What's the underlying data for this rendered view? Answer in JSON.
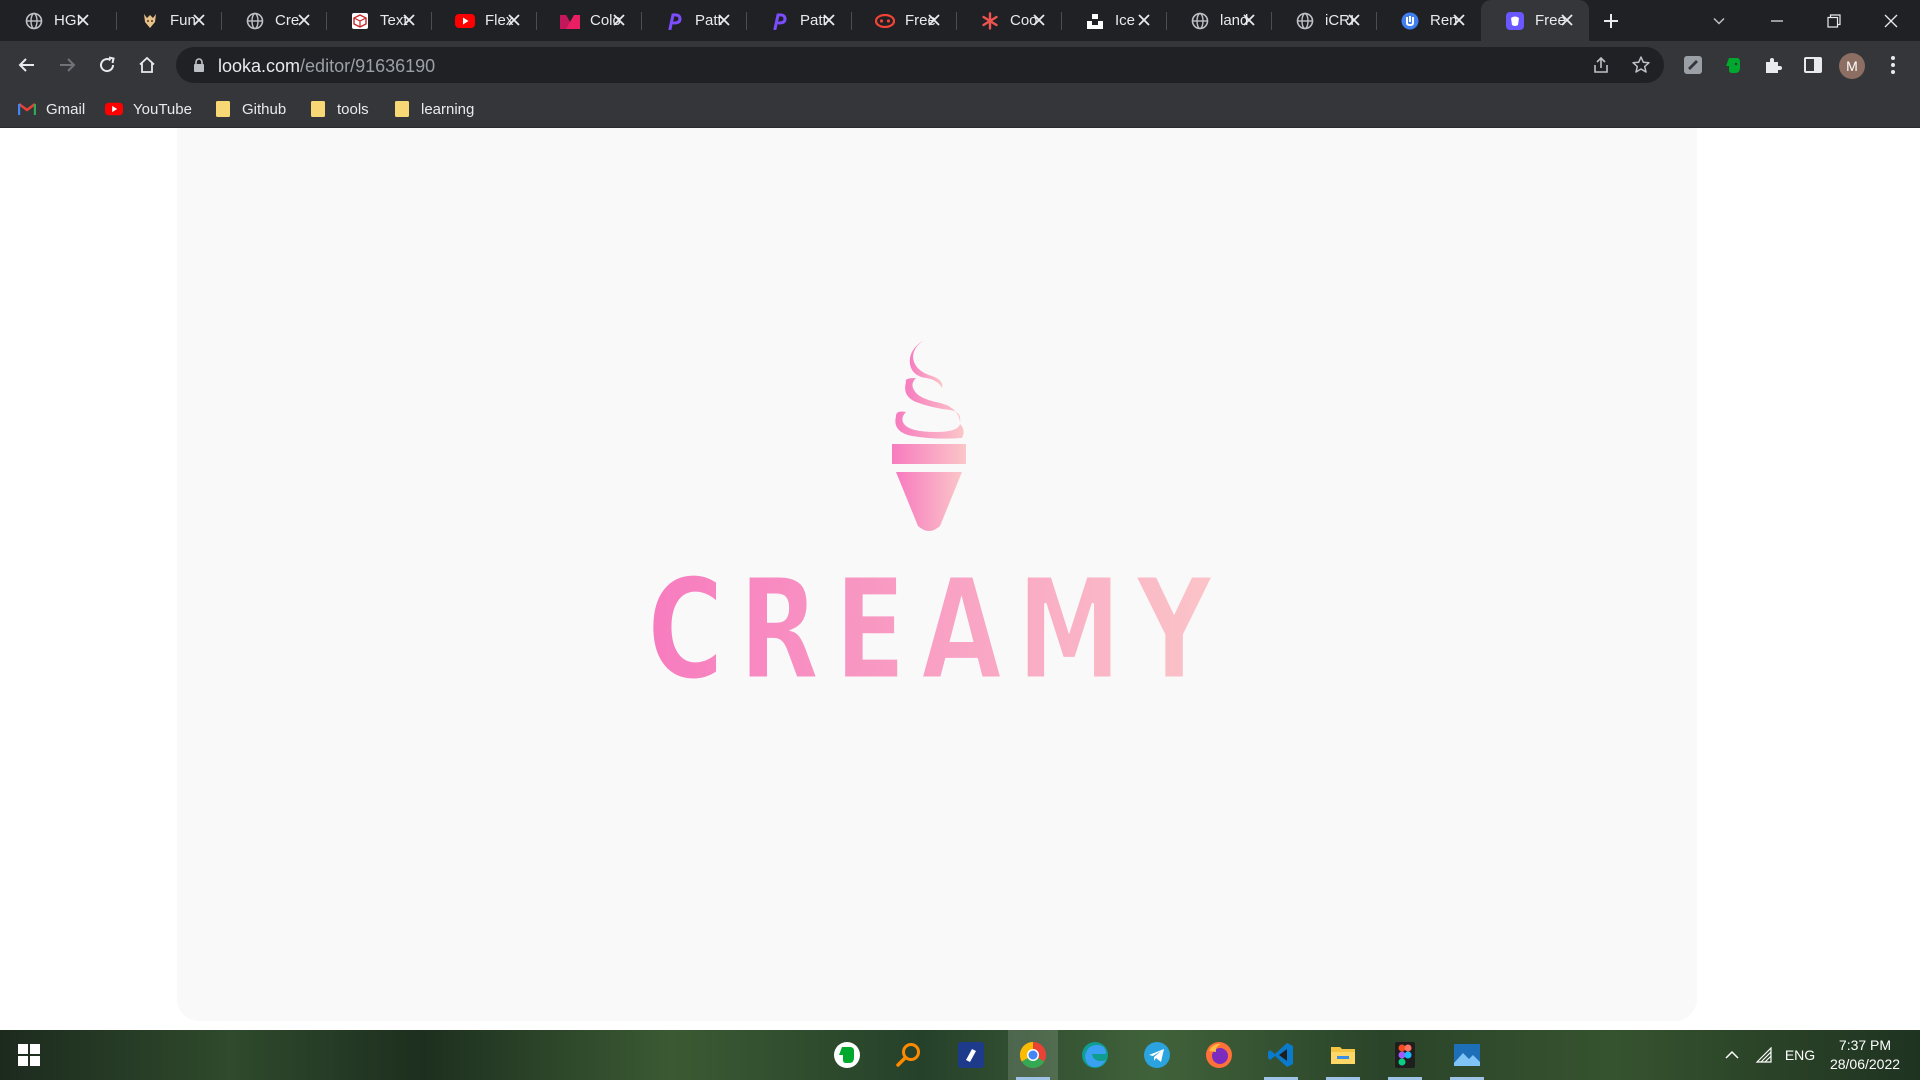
{
  "browser": {
    "tabs": [
      {
        "title": "HGI",
        "icon": "globe-icon"
      },
      {
        "title": "Fun",
        "icon": "lion-icon"
      },
      {
        "title": "Cre",
        "icon": "globe-icon"
      },
      {
        "title": "Text",
        "icon": "box-icon"
      },
      {
        "title": "Flex",
        "icon": "youtube-icon"
      },
      {
        "title": "Colo",
        "icon": "palette-icon"
      },
      {
        "title": "Patt",
        "icon": "pattern-icon"
      },
      {
        "title": "Patt",
        "icon": "pattern-icon"
      },
      {
        "title": "Free",
        "icon": "mask-icon"
      },
      {
        "title": "Coo",
        "icon": "asterisk-icon"
      },
      {
        "title": "Ice",
        "icon": "unsplash-icon"
      },
      {
        "title": "land",
        "icon": "globe-icon"
      },
      {
        "title": "iCRI",
        "icon": "globe-icon"
      },
      {
        "title": "Ren",
        "icon": "remove-bg-icon"
      },
      {
        "title": "Free",
        "icon": "logo-maker-icon",
        "active": true
      }
    ],
    "url": {
      "host": "looka.com",
      "path": "/editor/91636190"
    },
    "bookmarks": [
      {
        "label": "Gmail",
        "icon": "gmail-icon"
      },
      {
        "label": "YouTube",
        "icon": "youtube-icon"
      },
      {
        "label": "Github",
        "icon": "folder-icon"
      },
      {
        "label": "tools",
        "icon": "folder-icon"
      },
      {
        "label": "learning",
        "icon": "folder-icon"
      }
    ],
    "profile_initial": "M"
  },
  "logo": {
    "wordmark": "CREAMY",
    "icon": "ice-cream-icon",
    "gradient_colors": [
      "#f77bbf",
      "#fbc6c8"
    ]
  },
  "taskbar": {
    "apps": [
      "evernote-icon",
      "search-icon",
      "notes-icon",
      "chrome-icon",
      "edge-icon",
      "telegram-icon",
      "firefox-icon",
      "vscode-icon",
      "file-explorer-icon",
      "figma-icon",
      "photos-icon"
    ],
    "language": "ENG",
    "time": "7:37 PM",
    "date": "28/06/2022"
  }
}
